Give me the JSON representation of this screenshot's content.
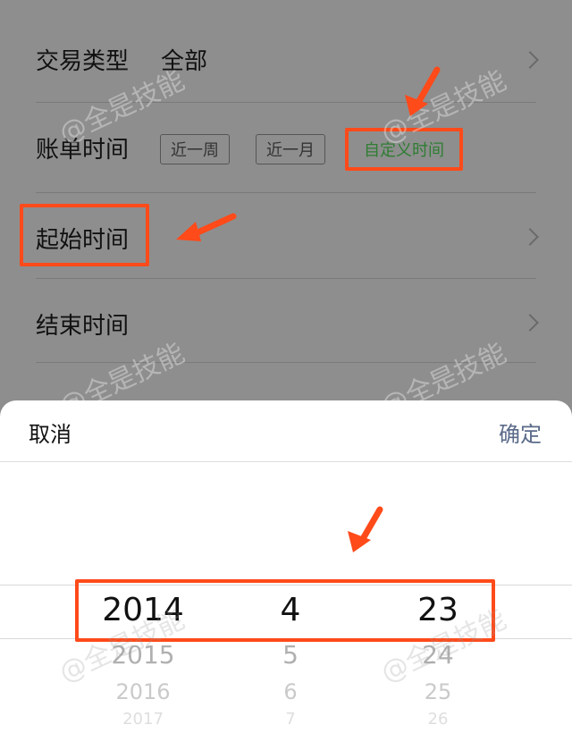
{
  "list": {
    "rows": [
      {
        "label": "交易类型",
        "value": "全部"
      },
      {
        "label": "账单时间"
      },
      {
        "label": "起始时间"
      },
      {
        "label": "结束时间"
      }
    ],
    "period_chips": [
      "近一周",
      "近一月",
      "自定义时间"
    ]
  },
  "watermark": "@全是技能",
  "sheet": {
    "cancel_label": "取消",
    "confirm_label": "确定",
    "year": {
      "selected": "2014",
      "next": [
        "2015",
        "2016",
        "2017"
      ]
    },
    "month": {
      "selected": "4",
      "next": [
        "5",
        "6",
        "7"
      ]
    },
    "day": {
      "selected": "23",
      "next": [
        "24",
        "25",
        "26"
      ]
    }
  },
  "colors": {
    "accent_red": "#ff4a1a",
    "active_chip_green": "#2e7d32",
    "confirm_blue_gray": "#5a6a8a"
  }
}
